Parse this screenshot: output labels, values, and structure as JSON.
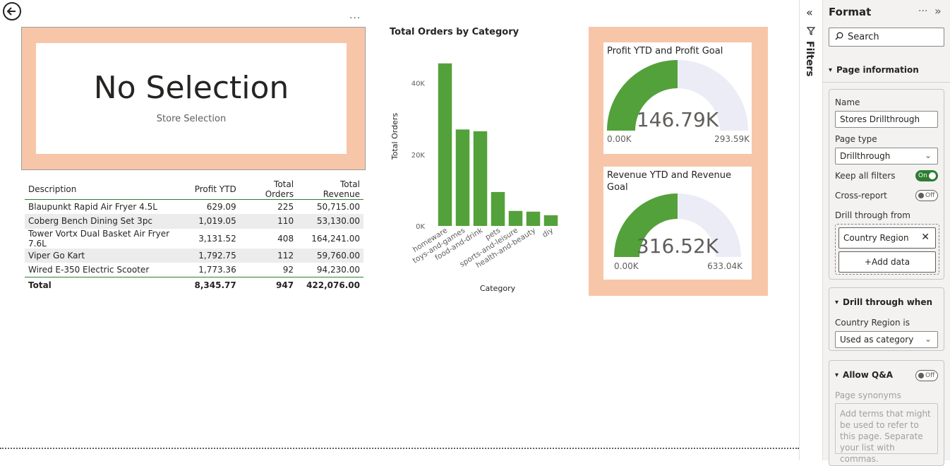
{
  "canvas": {
    "more_label": "...",
    "card": {
      "value": "No Selection",
      "label": "Store Selection"
    },
    "table": {
      "headers": [
        "Description",
        "Profit YTD",
        "Total Orders",
        "Total Revenue"
      ],
      "rows": [
        [
          "Blaupunkt Rapid Air Fryer 4.5L",
          "629.09",
          "225",
          "50,715.00"
        ],
        [
          "Coberg Bench Dining Set 3pc",
          "1,019.05",
          "110",
          "53,130.00"
        ],
        [
          "Tower Vortx Dual Basket Air Fryer 7.6L",
          "3,131.52",
          "408",
          "164,241.00"
        ],
        [
          "Viper Go Kart",
          "1,792.75",
          "112",
          "59,760.00"
        ],
        [
          "Wired E-350 Electric Scooter",
          "1,773.36",
          "92",
          "94,230.00"
        ]
      ],
      "total": [
        "Total",
        "8,345.77",
        "947",
        "422,076.00"
      ]
    },
    "gauges": [
      {
        "title": "Profit YTD and Profit Goal",
        "value_label": "146.79K",
        "min_label": "0.00K",
        "max_label": "293.59K",
        "fraction": 0.5
      },
      {
        "title": "Revenue YTD and Revenue Goal",
        "value_label": "316.52K",
        "min_label": "0.00K",
        "max_label": "633.04K",
        "fraction": 0.5
      }
    ],
    "colors": {
      "accent_green": "#53a13a",
      "card_peach": "#f7c6a8",
      "gauge_track": "#ececf7"
    }
  },
  "chart_data": {
    "type": "bar",
    "title": "Total Orders by Category",
    "xlabel": "Category",
    "ylabel": "Total Orders",
    "categories": [
      "homeware",
      "toys-and-games",
      "food-and-drink",
      "pets",
      "sports-and-leisure",
      "health-and-beauty",
      "diy"
    ],
    "values": [
      45500,
      27000,
      26500,
      9500,
      4200,
      4000,
      3000
    ],
    "yticks": [
      0,
      20000,
      40000
    ],
    "ytick_labels": [
      "0K",
      "20K",
      "40K"
    ],
    "ylim": [
      0,
      50000
    ],
    "color": "#53a13a",
    "grid": false,
    "legend": "none"
  },
  "filters": {
    "label": "Filters",
    "collapse_icon": "double-chevron-left-icon",
    "filter_icon": "funnel-icon"
  },
  "format_pane": {
    "title": "Format",
    "more_label": "···",
    "search_placeholder": "Search",
    "page_information": {
      "header": "Page information",
      "name_label": "Name",
      "name_value": "Stores Drillthrough",
      "page_type_label": "Page type",
      "page_type_value": "Drillthrough",
      "keep_filters_label": "Keep all filters",
      "keep_filters_state": "On",
      "cross_report_label": "Cross-report",
      "cross_report_state": "Off",
      "drill_from_label": "Drill through from",
      "drill_field": "Country Region",
      "add_data_label": "+Add data"
    },
    "drill_when": {
      "header": "Drill through when",
      "field_label": "Country Region is",
      "field_value": "Used as category"
    },
    "allow_qa": {
      "header": "Allow Q&A",
      "state": "Off",
      "synonyms_label": "Page synonyms",
      "synonyms_placeholder": "Add terms that might be used to refer to this page. Separate your list with commas."
    }
  }
}
